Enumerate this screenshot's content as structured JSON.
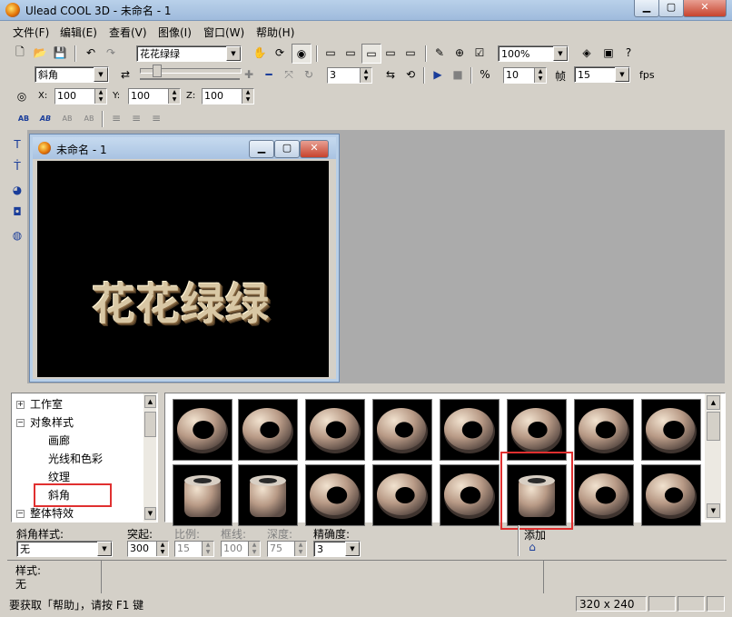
{
  "window": {
    "title": "Ulead COOL 3D - 未命名 - 1"
  },
  "menu": [
    "文件(F)",
    "编辑(E)",
    "查看(V)",
    "图像(I)",
    "窗口(W)",
    "帮助(H)"
  ],
  "toolbar": {
    "text_combo": "花花绿绿",
    "zoom_combo": "100%"
  },
  "animation_bar": {
    "effect_combo": "斜角",
    "frame_value": "3",
    "frame_count": "10",
    "frame_label": "帧",
    "fps_value": "15",
    "fps_label": "fps"
  },
  "position_bar": {
    "x_label": "X:",
    "x_value": "100",
    "y_label": "Y:",
    "y_value": "100",
    "z_label": "Z:",
    "z_value": "100"
  },
  "text_bar": {
    "b1": "AB",
    "b2": "AB",
    "b3": "AB",
    "b4": "AB"
  },
  "doc_window": {
    "title": "未命名 - 1",
    "art_text": "花花绿绿"
  },
  "tree": {
    "items": [
      {
        "label": "工作室",
        "exp": "+"
      },
      {
        "label": "对象样式",
        "exp": "−"
      },
      {
        "label": "画廊"
      },
      {
        "label": "光线和色彩"
      },
      {
        "label": "纹理"
      },
      {
        "label": "斜角"
      },
      {
        "label": "整体特效",
        "exp": "−"
      }
    ]
  },
  "properties": {
    "bevel_style_label": "斜角样式:",
    "bevel_style_value": "无",
    "bulge_label": "突起:",
    "bulge_value": "300",
    "ratio_label": "比例:",
    "ratio_value": "15",
    "border_label": "框线:",
    "border_value": "100",
    "depth_label": "深度:",
    "depth_value": "75",
    "precision_label": "精确度:",
    "precision_value": "3",
    "add_label": "添加"
  },
  "style_panel": {
    "label": "样式:",
    "value": "无"
  },
  "statusbar": {
    "help": "要获取「帮助」，请按 F1 键",
    "size": "320 x 240"
  },
  "colors": {
    "highlight": "#e03030",
    "title_gradient_top": "#b9d1ea"
  }
}
